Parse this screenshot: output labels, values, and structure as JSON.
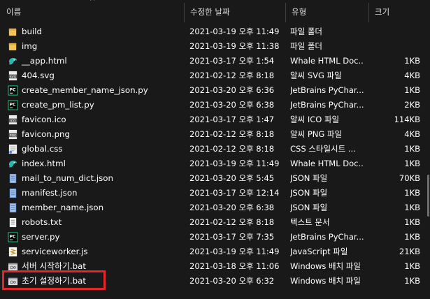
{
  "header": {
    "name": "이름",
    "date": "수정한 날짜",
    "type": "유형",
    "size": "크기"
  },
  "files": [
    {
      "name": "build",
      "date": "2021-03-19 오후 11:49",
      "type": "파일 폴더",
      "size": "",
      "icon": "folder-icon"
    },
    {
      "name": "img",
      "date": "2021-03-19 오후 11:38",
      "type": "파일 폴더",
      "size": "",
      "icon": "folder-icon"
    },
    {
      "name": "__app.html",
      "date": "2021-03-17 오후 1:54",
      "type": "Whale HTML Doc...",
      "size": "1KB",
      "icon": "whale-html-icon"
    },
    {
      "name": "404.svg",
      "date": "2021-02-12 오후 8:18",
      "type": "알씨 SVG 파일",
      "size": "4KB",
      "icon": "svg-file-icon"
    },
    {
      "name": "create_member_name_json.py",
      "date": "2021-03-20 오후 6:36",
      "type": "JetBrains PyChar...",
      "size": "1KB",
      "icon": "pycharm-icon"
    },
    {
      "name": "create_pm_list.py",
      "date": "2021-03-20 오후 6:38",
      "type": "JetBrains PyChar...",
      "size": "2KB",
      "icon": "pycharm-icon"
    },
    {
      "name": "favicon.ico",
      "date": "2021-03-17 오후 1:47",
      "type": "알씨 ICO 파일",
      "size": "114KB",
      "icon": "ico-file-icon"
    },
    {
      "name": "favicon.png",
      "date": "2021-02-12 오후 8:18",
      "type": "알씨 PNG 파일",
      "size": "4KB",
      "icon": "png-file-icon"
    },
    {
      "name": "global.css",
      "date": "2021-02-12 오후 8:18",
      "type": "CSS 스타일시트 ...",
      "size": "1KB",
      "icon": "css-file-icon"
    },
    {
      "name": "index.html",
      "date": "2021-03-19 오후 11:49",
      "type": "Whale HTML Doc...",
      "size": "1KB",
      "icon": "whale-html-icon"
    },
    {
      "name": "mail_to_num_dict.json",
      "date": "2021-03-20 오후 5:45",
      "type": "JSON 파일",
      "size": "70KB",
      "icon": "json-file-icon"
    },
    {
      "name": "manifest.json",
      "date": "2021-03-17 오후 12:14",
      "type": "JSON 파일",
      "size": "1KB",
      "icon": "json-file-icon"
    },
    {
      "name": "member_name.json",
      "date": "2021-03-20 오후 6:38",
      "type": "JSON 파일",
      "size": "1KB",
      "icon": "json-file-icon"
    },
    {
      "name": "robots.txt",
      "date": "2021-02-12 오후 8:18",
      "type": "텍스트 문서",
      "size": "1KB",
      "icon": "text-file-icon"
    },
    {
      "name": "server.py",
      "date": "2021-03-17 오후 7:35",
      "type": "JetBrains PyChar...",
      "size": "1KB",
      "icon": "pycharm-icon"
    },
    {
      "name": "serviceworker.js",
      "date": "2021-03-19 오후 11:49",
      "type": "JavaScript 파일",
      "size": "21KB",
      "icon": "js-file-icon"
    },
    {
      "name": "서버 시작하기.bat",
      "date": "2021-03-18 오후 11:06",
      "type": "Windows 배치 파일",
      "size": "1KB",
      "icon": "bat-file-icon"
    },
    {
      "name": "초기 설정하기.bat",
      "date": "2021-03-20 오후 6:32",
      "type": "Windows 배치 파일",
      "size": "1KB",
      "icon": "bat-file-icon",
      "highlighted": true
    }
  ],
  "colors": {
    "highlight": "#e4262a",
    "background": "#191919"
  }
}
